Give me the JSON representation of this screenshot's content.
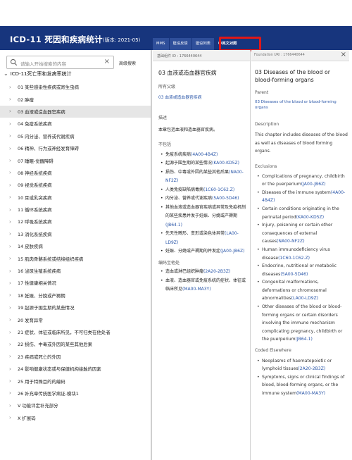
{
  "header": {
    "app_title": "ICD-11 死因和疾病统计",
    "version": "(版本:  2021-05)"
  },
  "tabs": [
    {
      "label": "MMS",
      "active": false
    },
    {
      "label": "建设反馈",
      "active": false
    },
    {
      "label": "建设列表",
      "active": false
    },
    {
      "label": "中英文对照",
      "active": true
    }
  ],
  "search": {
    "placeholder": "请输入开始搜索的内容",
    "advanced_label": "高级搜索"
  },
  "tree": {
    "root_label": "ICD-11死亡率和发病率统计",
    "items": [
      {
        "label": "01 某些感染性疾病或寄生虫病",
        "selected": false
      },
      {
        "label": "02 肿瘤",
        "selected": false
      },
      {
        "label": "03 血液或造血器官疾病",
        "selected": true
      },
      {
        "label": "04 免疫系统疾病",
        "selected": false
      },
      {
        "label": "05 内分泌、营养或代谢疾病",
        "selected": false
      },
      {
        "label": "06 精神、行为或神经发育障碍",
        "selected": false
      },
      {
        "label": "07 睡眠-觉醒障碍",
        "selected": false
      },
      {
        "label": "08 神经系统疾病",
        "selected": false
      },
      {
        "label": "09 视觉系统疾病",
        "selected": false
      },
      {
        "label": "10 耳或乳突疾病",
        "selected": false
      },
      {
        "label": "11 循环系统疾病",
        "selected": false
      },
      {
        "label": "12 呼吸系统疾病",
        "selected": false
      },
      {
        "label": "13 消化系统疾病",
        "selected": false
      },
      {
        "label": "14 皮肤疾病",
        "selected": false
      },
      {
        "label": "15 肌肉骨骼系统或结缔组织疾病",
        "selected": false
      },
      {
        "label": "16 泌尿生殖系统疾病",
        "selected": false
      },
      {
        "label": "17 性健康相关情况",
        "selected": false
      },
      {
        "label": "18 妊娠、分娩或产褥期",
        "selected": false
      },
      {
        "label": "19 起源于围生期的某些情况",
        "selected": false
      },
      {
        "label": "20 发育异常",
        "selected": false
      },
      {
        "label": "21 症状、体征或临床所见，不可归类在他处者",
        "selected": false
      },
      {
        "label": "22 损伤、中毒或外因的某些其他后果",
        "selected": false
      },
      {
        "label": "23 疾病或死亡的外因",
        "selected": false
      },
      {
        "label": "24 影响健康状态或与保健机构接触的因素",
        "selected": false
      },
      {
        "label": "25 用于特殊目的的编码",
        "selected": false
      },
      {
        "label": "26 补充章传统医学病证-模块1",
        "selected": false
      },
      {
        "label": "V 功能评定补充部分",
        "selected": false
      },
      {
        "label": "X 扩展码",
        "selected": false
      }
    ]
  },
  "middle": {
    "uri": "基础组件 ID : 1766440644",
    "title": "03 血液或造血器官疾病",
    "parent_heading": "所有父级",
    "parent_link": "03 血液或造血器官疾病",
    "desc_heading": "描述",
    "desc_text": "本章包括血液和造血器官疾病。",
    "excl_heading": "不包括",
    "exclusions": [
      {
        "text": "免疫系统疾病",
        "code": "(4A00-4B4Z)"
      },
      {
        "text": "起源于围生期的某些情况",
        "code": "(KA00-KD5Z)"
      },
      {
        "text": "损伤、中毒或外因的某些其他后果",
        "code": "(NA00-NF2Z)"
      },
      {
        "text": "人类免疫缺陷病毒病",
        "code": "(1C60-1C62.Z)"
      },
      {
        "text": "内分泌、营养或代谢疾病",
        "code": "(5A00-5D46)"
      },
      {
        "text": "其他血液或造血器官疾病或异常及免疫机制的某些疾患并发于妊娠、分娩或产褥期",
        "code": "(JB64.1)"
      },
      {
        "text": "先天性畸形、变形或染色体异常",
        "code": "(LA00-LD9Z)"
      },
      {
        "text": "妊娠、分娩或产褥期的并发症",
        "code": "(JA00-JB6Z)"
      }
    ],
    "coded_heading": "编码至他处",
    "coded_elsewhere": [
      {
        "text": "造血或淋巴组织肿瘤",
        "code": "(2A20-2B3Z)"
      },
      {
        "text": "血液、造血器官或免疫系统的症状、体征或临床所见",
        "code": "(MA00-MA3Y)"
      }
    ]
  },
  "right": {
    "uri": "Foundation URI : 1766440644",
    "title": "03 Diseases of the blood or blood-forming organs",
    "parent_heading": "Parent",
    "parent_link": "03 Diseases of the blood or blood-forming organs",
    "desc_heading": "Description",
    "desc_text": "This chapter includes diseases of the blood as well as diseases of blood forming organs.",
    "excl_heading": "Exclusions",
    "exclusions": [
      {
        "text": "Complications of pregnancy, childbirth or the puerperium",
        "code": "(JA00-JB6Z)"
      },
      {
        "text": "Diseases of the immune system",
        "code": "(4A00-4B4Z)"
      },
      {
        "text": "Certain conditions originating in the perinatal period",
        "code": "(KA00-KD5Z)"
      },
      {
        "text": "Injury, poisoning or certain other consequences of external causes",
        "code": "(NA00-NF2Z)"
      },
      {
        "text": "Human immunodeficiency virus disease",
        "code": "(1C60-1C62.Z)"
      },
      {
        "text": "Endocrine, nutritional or metabolic diseases",
        "code": "(5A00-5D46)"
      },
      {
        "text": "Congenital malformations, deformations or chromosomal abnormalities",
        "code": "(LA00-LD9Z)"
      },
      {
        "text": "Other diseases of the blood or blood-forming organs or certain disorders involving the immune mechanism complicating pregnancy, childbirth or the puerperium",
        "code": "(JB64.1)"
      }
    ],
    "coded_heading": "Coded Elsewhere",
    "coded_elsewhere": [
      {
        "text": "Neoplasms of haematopoietic or lymphoid tissues",
        "code": "(2A20-2B3Z)"
      },
      {
        "text": "Symptoms, signs or clinical findings of blood, blood-forming organs, or the immune system",
        "code": "(MA00-MA3Y)"
      }
    ]
  },
  "colors": {
    "header_bg": "#17357d",
    "link": "#2a56a8",
    "highlight_box": "#e01818",
    "selected_row": "#e6e6e6"
  },
  "icons": {
    "search": "search-icon",
    "clear": "close-icon",
    "expand": "chevron-right-icon",
    "collapse": "chevron-down-icon",
    "close_panel": "close-icon"
  }
}
